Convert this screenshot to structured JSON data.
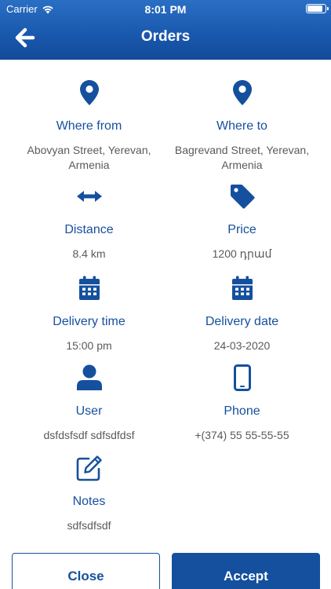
{
  "status_bar": {
    "carrier": "Carrier",
    "time": "8:01 PM",
    "battery_level": 0.9
  },
  "header": {
    "title": "Orders"
  },
  "details": {
    "where_from": {
      "label": "Where from",
      "value": "Abovyan Street, Yerevan, Armenia",
      "icon": "location-pin-icon"
    },
    "where_to": {
      "label": "Where to",
      "value": "Bagrevand Street, Yerevan, Armenia",
      "icon": "location-pin-icon"
    },
    "distance": {
      "label": "Distance",
      "value": "8.4 km",
      "icon": "horizontal-arrows-icon"
    },
    "price": {
      "label": "Price",
      "value": "1200 դրամ",
      "icon": "price-tag-icon"
    },
    "delivery_time": {
      "label": "Delivery time",
      "value": "15:00 pm",
      "icon": "calendar-icon"
    },
    "delivery_date": {
      "label": "Delivery date",
      "value": "24-03-2020",
      "icon": "calendar-icon"
    },
    "user": {
      "label": "User",
      "value": "dsfdsfsdf sdfsdfdsf",
      "icon": "user-icon"
    },
    "phone": {
      "label": "Phone",
      "value": "+(374) 55 55-55-55",
      "icon": "mobile-phone-icon"
    },
    "notes": {
      "label": "Notes",
      "value": "sdfsdfsdf",
      "icon": "edit-icon"
    }
  },
  "buttons": {
    "close": "Close",
    "accept": "Accept"
  },
  "colors": {
    "primary": "#15509e",
    "header_gradient_top": "#2a6fc4",
    "value_text": "#5a5a5a"
  }
}
